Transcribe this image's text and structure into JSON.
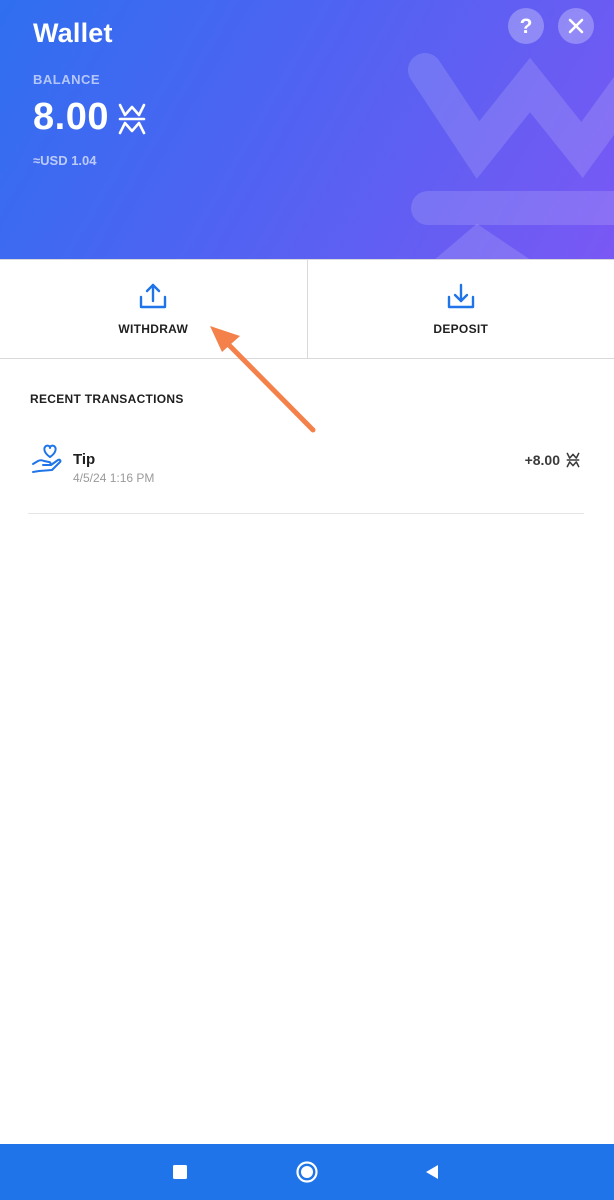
{
  "header": {
    "title": "Wallet",
    "help_label": "?",
    "balance_label": "BALANCE",
    "balance_amount": "8.00",
    "usd_equivalent": "≈USD 1.04",
    "coin_icon": "wm-coin-icon"
  },
  "actions": {
    "withdraw_label": "WITHDRAW",
    "deposit_label": "DEPOSIT"
  },
  "transactions": {
    "section_title": "RECENT TRANSACTIONS",
    "items": [
      {
        "name": "Tip",
        "date": "4/5/24 1:16 PM",
        "amount": "+8.00",
        "icon": "heart-hand-icon"
      }
    ]
  },
  "colors": {
    "header_gradient_start": "#2f6ff0",
    "header_gradient_end": "#7a58f4",
    "accent": "#1e74e8",
    "annotation_arrow": "#f4804a"
  }
}
